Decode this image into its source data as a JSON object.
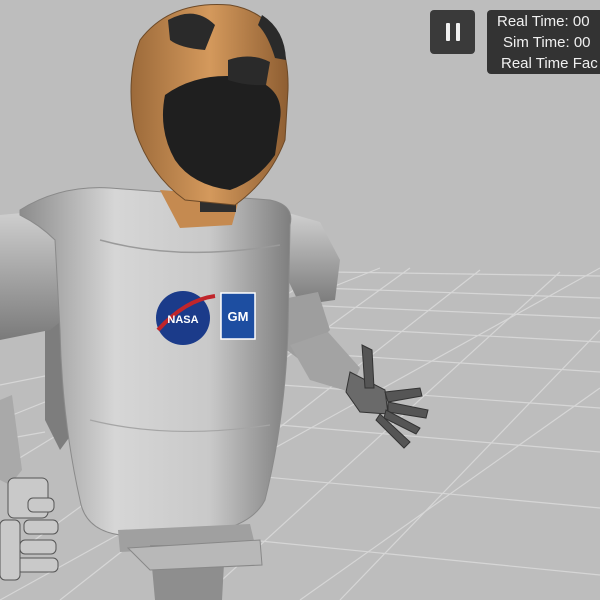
{
  "toolbar": {
    "pause_icon": "pause-icon"
  },
  "stats": {
    "real_time": "Real Time: 00",
    "sim_time": "Sim Time: 00",
    "real_time_factor": "Real Time Fac"
  },
  "robot": {
    "chest_logo_left": "NASA",
    "chest_logo_right": "GM"
  },
  "colors": {
    "background": "#bdbdbd",
    "grid": "#d4d4d4",
    "helmet": "#c6874a",
    "overlay": "#333333"
  }
}
